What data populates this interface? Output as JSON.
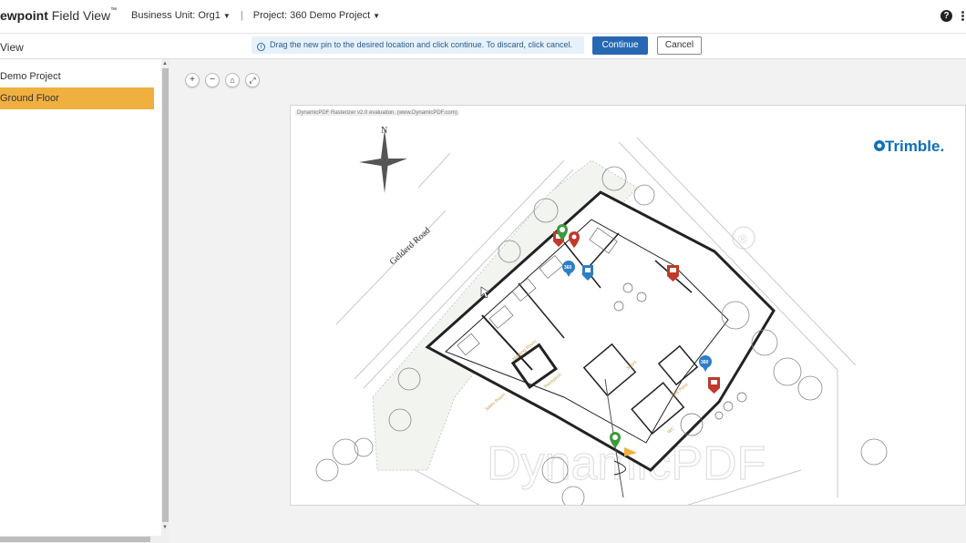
{
  "header": {
    "brand_bold": "ewpoint",
    "brand_rest": "Field View",
    "brand_tm": "™",
    "business_unit_label": "Business Unit:",
    "business_unit_value": "Org1",
    "separator": "|",
    "project_label": "Project:",
    "project_value": "360 Demo Project",
    "help_icon": "?"
  },
  "subbar": {
    "view_title": "View",
    "notice_text": "Drag the new pin to the desired location and click continue. To discard, click cancel.",
    "continue_label": "Continue",
    "cancel_label": "Cancel"
  },
  "sidebar": {
    "project": "Demo Project",
    "floor": "Ground Floor"
  },
  "zoom_controls": {
    "zoom_in": "+",
    "zoom_out": "−",
    "home": "⌂",
    "fit": "⤢"
  },
  "plan": {
    "watermark": "DynamicPDF Rasterizer v2.0 evaluation. (www.DynamicPDF.com)",
    "north": "N",
    "road_label": "Gelderd Road",
    "logo_text": "Trimble.",
    "bg_watermark": "DynamicPDF",
    "registered": "®",
    "pin_360_label": "360"
  },
  "colors": {
    "accent_blue": "#2768b3",
    "selected_row": "#f0b03f",
    "pin_red": "#c0392b",
    "pin_green": "#3d9a3d",
    "pin_blue": "#2f7ec4",
    "trimble_blue": "#0f6fb5"
  }
}
